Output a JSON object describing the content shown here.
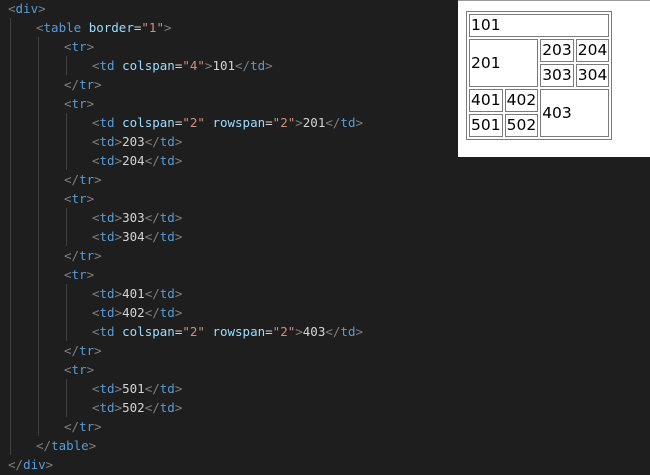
{
  "editor": {
    "lines": [
      {
        "indent": 0,
        "tokens": [
          {
            "t": "<",
            "c": "bracket"
          },
          {
            "t": "div",
            "c": "tag"
          },
          {
            "t": ">",
            "c": "bracket"
          }
        ]
      },
      {
        "indent": 1,
        "tokens": [
          {
            "t": "<",
            "c": "bracket"
          },
          {
            "t": "table",
            "c": "tag"
          },
          {
            "t": " "
          },
          {
            "t": "border",
            "c": "attr"
          },
          {
            "t": "=",
            "c": "eq"
          },
          {
            "t": "\"1\"",
            "c": "val"
          },
          {
            "t": ">",
            "c": "bracket"
          }
        ]
      },
      {
        "indent": 2,
        "tokens": [
          {
            "t": "<",
            "c": "bracket"
          },
          {
            "t": "tr",
            "c": "tag"
          },
          {
            "t": ">",
            "c": "bracket"
          }
        ]
      },
      {
        "indent": 3,
        "tokens": [
          {
            "t": "<",
            "c": "bracket"
          },
          {
            "t": "td",
            "c": "tag"
          },
          {
            "t": " "
          },
          {
            "t": "colspan",
            "c": "attr"
          },
          {
            "t": "=",
            "c": "eq"
          },
          {
            "t": "\"4\"",
            "c": "val"
          },
          {
            "t": ">",
            "c": "bracket"
          },
          {
            "t": "101",
            "c": "text"
          },
          {
            "t": "</",
            "c": "bracket"
          },
          {
            "t": "td",
            "c": "tag"
          },
          {
            "t": ">",
            "c": "bracket"
          }
        ]
      },
      {
        "indent": 2,
        "tokens": [
          {
            "t": "</",
            "c": "bracket"
          },
          {
            "t": "tr",
            "c": "tag"
          },
          {
            "t": ">",
            "c": "bracket"
          }
        ]
      },
      {
        "indent": 2,
        "tokens": [
          {
            "t": "<",
            "c": "bracket"
          },
          {
            "t": "tr",
            "c": "tag"
          },
          {
            "t": ">",
            "c": "bracket"
          }
        ]
      },
      {
        "indent": 3,
        "tokens": [
          {
            "t": "<",
            "c": "bracket"
          },
          {
            "t": "td",
            "c": "tag"
          },
          {
            "t": " "
          },
          {
            "t": "colspan",
            "c": "attr"
          },
          {
            "t": "=",
            "c": "eq"
          },
          {
            "t": "\"2\"",
            "c": "val"
          },
          {
            "t": " "
          },
          {
            "t": "rowspan",
            "c": "attr"
          },
          {
            "t": "=",
            "c": "eq"
          },
          {
            "t": "\"2\"",
            "c": "val"
          },
          {
            "t": ">",
            "c": "bracket"
          },
          {
            "t": "201",
            "c": "text"
          },
          {
            "t": "</",
            "c": "bracket"
          },
          {
            "t": "td",
            "c": "tag"
          },
          {
            "t": ">",
            "c": "bracket"
          }
        ]
      },
      {
        "indent": 3,
        "tokens": [
          {
            "t": "<",
            "c": "bracket"
          },
          {
            "t": "td",
            "c": "tag"
          },
          {
            "t": ">",
            "c": "bracket"
          },
          {
            "t": "203",
            "c": "text"
          },
          {
            "t": "</",
            "c": "bracket"
          },
          {
            "t": "td",
            "c": "tag"
          },
          {
            "t": ">",
            "c": "bracket"
          }
        ]
      },
      {
        "indent": 3,
        "tokens": [
          {
            "t": "<",
            "c": "bracket"
          },
          {
            "t": "td",
            "c": "tag"
          },
          {
            "t": ">",
            "c": "bracket"
          },
          {
            "t": "204",
            "c": "text"
          },
          {
            "t": "</",
            "c": "bracket"
          },
          {
            "t": "td",
            "c": "tag"
          },
          {
            "t": ">",
            "c": "bracket"
          }
        ]
      },
      {
        "indent": 2,
        "tokens": [
          {
            "t": "</",
            "c": "bracket"
          },
          {
            "t": "tr",
            "c": "tag"
          },
          {
            "t": ">",
            "c": "bracket"
          }
        ]
      },
      {
        "indent": 2,
        "tokens": [
          {
            "t": "<",
            "c": "bracket"
          },
          {
            "t": "tr",
            "c": "tag"
          },
          {
            "t": ">",
            "c": "bracket"
          }
        ]
      },
      {
        "indent": 3,
        "tokens": [
          {
            "t": "<",
            "c": "bracket"
          },
          {
            "t": "td",
            "c": "tag"
          },
          {
            "t": ">",
            "c": "bracket"
          },
          {
            "t": "303",
            "c": "text"
          },
          {
            "t": "</",
            "c": "bracket"
          },
          {
            "t": "td",
            "c": "tag"
          },
          {
            "t": ">",
            "c": "bracket"
          }
        ]
      },
      {
        "indent": 3,
        "tokens": [
          {
            "t": "<",
            "c": "bracket"
          },
          {
            "t": "td",
            "c": "tag"
          },
          {
            "t": ">",
            "c": "bracket"
          },
          {
            "t": "304",
            "c": "text"
          },
          {
            "t": "</",
            "c": "bracket"
          },
          {
            "t": "td",
            "c": "tag"
          },
          {
            "t": ">",
            "c": "bracket"
          }
        ]
      },
      {
        "indent": 2,
        "tokens": [
          {
            "t": "</",
            "c": "bracket"
          },
          {
            "t": "tr",
            "c": "tag"
          },
          {
            "t": ">",
            "c": "bracket"
          }
        ]
      },
      {
        "indent": 2,
        "tokens": [
          {
            "t": "<",
            "c": "bracket"
          },
          {
            "t": "tr",
            "c": "tag"
          },
          {
            "t": ">",
            "c": "bracket"
          }
        ]
      },
      {
        "indent": 3,
        "tokens": [
          {
            "t": "<",
            "c": "bracket"
          },
          {
            "t": "td",
            "c": "tag"
          },
          {
            "t": ">",
            "c": "bracket"
          },
          {
            "t": "401",
            "c": "text"
          },
          {
            "t": "</",
            "c": "bracket"
          },
          {
            "t": "td",
            "c": "tag"
          },
          {
            "t": ">",
            "c": "bracket"
          }
        ]
      },
      {
        "indent": 3,
        "tokens": [
          {
            "t": "<",
            "c": "bracket"
          },
          {
            "t": "td",
            "c": "tag"
          },
          {
            "t": ">",
            "c": "bracket"
          },
          {
            "t": "402",
            "c": "text"
          },
          {
            "t": "</",
            "c": "bracket"
          },
          {
            "t": "td",
            "c": "tag"
          },
          {
            "t": ">",
            "c": "bracket"
          }
        ]
      },
      {
        "indent": 3,
        "tokens": [
          {
            "t": "<",
            "c": "bracket"
          },
          {
            "t": "td",
            "c": "tag"
          },
          {
            "t": " "
          },
          {
            "t": "colspan",
            "c": "attr"
          },
          {
            "t": "=",
            "c": "eq"
          },
          {
            "t": "\"2\"",
            "c": "val"
          },
          {
            "t": " "
          },
          {
            "t": "rowspan",
            "c": "attr"
          },
          {
            "t": "=",
            "c": "eq"
          },
          {
            "t": "\"2\"",
            "c": "val"
          },
          {
            "t": ">",
            "c": "bracket"
          },
          {
            "t": "403",
            "c": "text"
          },
          {
            "t": "</",
            "c": "bracket"
          },
          {
            "t": "td",
            "c": "tag"
          },
          {
            "t": ">",
            "c": "bracket"
          }
        ]
      },
      {
        "indent": 2,
        "tokens": [
          {
            "t": "</",
            "c": "bracket"
          },
          {
            "t": "tr",
            "c": "tag"
          },
          {
            "t": ">",
            "c": "bracket"
          }
        ]
      },
      {
        "indent": 2,
        "tokens": [
          {
            "t": "<",
            "c": "bracket"
          },
          {
            "t": "tr",
            "c": "tag"
          },
          {
            "t": ">",
            "c": "bracket"
          }
        ]
      },
      {
        "indent": 3,
        "tokens": [
          {
            "t": "<",
            "c": "bracket"
          },
          {
            "t": "td",
            "c": "tag"
          },
          {
            "t": ">",
            "c": "bracket"
          },
          {
            "t": "501",
            "c": "text"
          },
          {
            "t": "</",
            "c": "bracket"
          },
          {
            "t": "td",
            "c": "tag"
          },
          {
            "t": ">",
            "c": "bracket"
          }
        ]
      },
      {
        "indent": 3,
        "tokens": [
          {
            "t": "<",
            "c": "bracket"
          },
          {
            "t": "td",
            "c": "tag"
          },
          {
            "t": ">",
            "c": "bracket"
          },
          {
            "t": "502",
            "c": "text"
          },
          {
            "t": "</",
            "c": "bracket"
          },
          {
            "t": "td",
            "c": "tag"
          },
          {
            "t": ">",
            "c": "bracket"
          }
        ]
      },
      {
        "indent": 2,
        "tokens": [
          {
            "t": "</",
            "c": "bracket"
          },
          {
            "t": "tr",
            "c": "tag"
          },
          {
            "t": ">",
            "c": "bracket"
          }
        ]
      },
      {
        "indent": 1,
        "tokens": [
          {
            "t": "</",
            "c": "bracket"
          },
          {
            "t": "table",
            "c": "tag"
          },
          {
            "t": ">",
            "c": "bracket"
          }
        ]
      },
      {
        "indent": 0,
        "tokens": [
          {
            "t": "</",
            "c": "bracket"
          },
          {
            "t": "div",
            "c": "tag"
          },
          {
            "t": ">",
            "c": "bracket"
          }
        ]
      }
    ]
  },
  "preview": {
    "rows": [
      [
        {
          "text": "101",
          "colspan": 4
        }
      ],
      [
        {
          "text": "201",
          "colspan": 2,
          "rowspan": 2
        },
        {
          "text": "203"
        },
        {
          "text": "204"
        }
      ],
      [
        {
          "text": "303"
        },
        {
          "text": "304"
        }
      ],
      [
        {
          "text": "401"
        },
        {
          "text": "402"
        },
        {
          "text": "403",
          "colspan": 2,
          "rowspan": 2
        }
      ],
      [
        {
          "text": "501"
        },
        {
          "text": "502"
        }
      ]
    ]
  },
  "colors": {
    "editor_background": "#1e1e1e",
    "tag": "#569cd6",
    "attribute": "#9cdcfe",
    "string": "#ce9178",
    "bracket": "#808080",
    "text": "#d4d4d4",
    "preview_background": "#ffffff"
  }
}
